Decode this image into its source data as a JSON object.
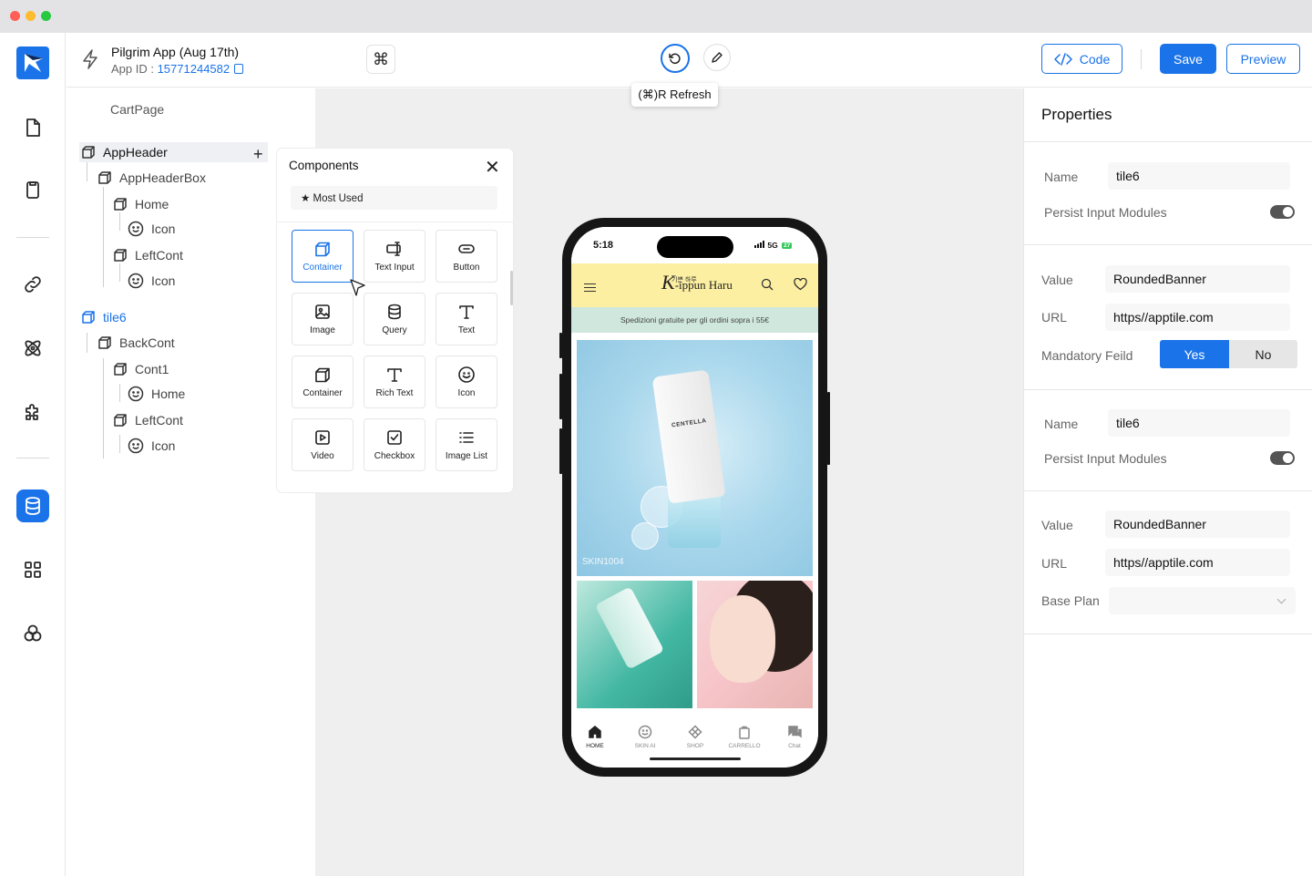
{
  "topbar": {
    "app_title": "Pilgrim App (Aug 17th)",
    "app_id_label": "App ID : ",
    "app_id_value": "15771244582",
    "cmd_symbol": "⌘",
    "tooltip": "(⌘)R  Refresh",
    "code_label": "Code",
    "save_label": "Save",
    "preview_label": "Preview"
  },
  "tree": {
    "root": "CartPage",
    "items": [
      {
        "label": "AppHeader"
      },
      {
        "label": "AppHeaderBox"
      },
      {
        "label": "Home"
      },
      {
        "label": "Icon"
      },
      {
        "label": "LeftCont"
      },
      {
        "label": "Icon"
      },
      {
        "label": "tile6"
      },
      {
        "label": "BackCont"
      },
      {
        "label": "Cont1"
      },
      {
        "label": "Home"
      },
      {
        "label": "LeftCont"
      },
      {
        "label": "Icon"
      }
    ],
    "add_symbol": "+"
  },
  "components": {
    "title": "Components",
    "close_symbol": "✕",
    "filter": "★ Most Used",
    "tiles": [
      {
        "label": "Container",
        "icon": "cube-icon"
      },
      {
        "label": "Text Input",
        "icon": "text-input-icon"
      },
      {
        "label": "Button",
        "icon": "button-icon"
      },
      {
        "label": "Image",
        "icon": "image-icon"
      },
      {
        "label": "Query",
        "icon": "database-icon"
      },
      {
        "label": "Text",
        "icon": "text-icon"
      },
      {
        "label": "Container",
        "icon": "cube-icon"
      },
      {
        "label": "Rich Text",
        "icon": "rich-text-icon"
      },
      {
        "label": "Icon",
        "icon": "smile-icon"
      },
      {
        "label": "Video",
        "icon": "video-icon"
      },
      {
        "label": "Checkbox",
        "icon": "checkbox-icon"
      },
      {
        "label": "Image List",
        "icon": "list-icon"
      }
    ]
  },
  "phone": {
    "time": "5:18",
    "network": "5G",
    "battery": "27",
    "brand_sub": "기쁜 하루",
    "brand_k": "K",
    "brand": "-ippun Haru",
    "shipping_banner": "Spedizioni gratuite per gli ordini sopra i 55€",
    "hero_watermark": "SKIN1004",
    "product_label": "CENTELLA",
    "nav": [
      {
        "label": "HOME"
      },
      {
        "label": "SKIN AI"
      },
      {
        "label": "SHOP"
      },
      {
        "label": "CARRELLO"
      },
      {
        "label": "Chat"
      }
    ]
  },
  "properties": {
    "title": "Properties",
    "section1": {
      "name_label": "Name",
      "name_value": "tile6",
      "persist_label": "Persist Input Modules"
    },
    "section2": {
      "value_label": "Value",
      "value_value": "RoundedBanner",
      "url_label": "URL",
      "url_value": "https//apptile.com",
      "mandatory_label": "Mandatory Feild",
      "yes": "Yes",
      "no": "No"
    },
    "section3": {
      "name_label": "Name",
      "name_value": "tile6",
      "persist_label": "Persist Input Modules"
    },
    "section4": {
      "value_label": "Value",
      "value_value": "RoundedBanner",
      "url_label": "URL",
      "url_value": "https//apptile.com",
      "base_plan_label": "Base Plan",
      "base_plan_value": ""
    }
  },
  "colors": {
    "accent": "#1a73e8",
    "banner_yellow": "#fcefa1",
    "banner_green": "#cfe7dc"
  }
}
